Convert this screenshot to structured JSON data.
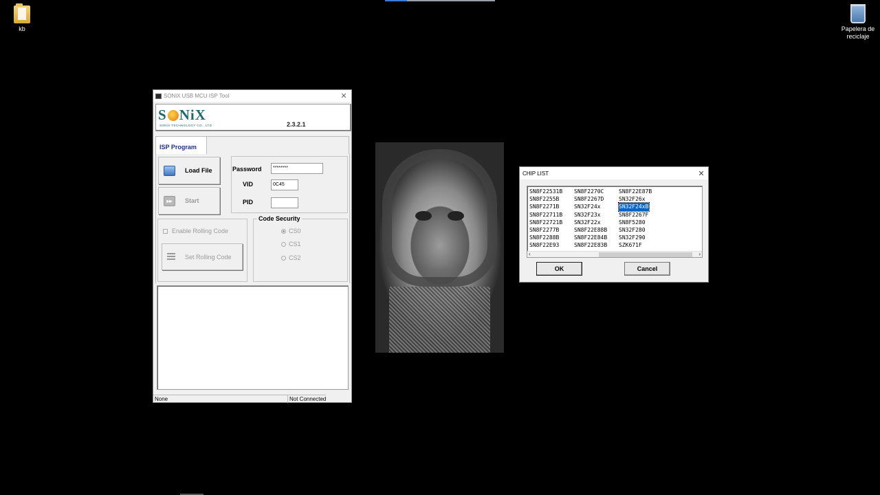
{
  "desktop": {
    "icons": [
      {
        "label": "kb"
      },
      {
        "label": "Papelera de reciclaje"
      }
    ]
  },
  "isp_window": {
    "title": "SONiX USB MCU ISP Tool",
    "logo": {
      "text_a": "S",
      "text_b": "NiX",
      "subtitle": "SONiX TECHNOLOGY CO., LTD"
    },
    "version": "2.3.2.1",
    "tab": "ISP Program",
    "load_file": "Load File",
    "start": "Start",
    "password_label": "Password",
    "password_value": "********",
    "vid_label": "VID",
    "vid_value": "0C45",
    "pid_label": "PID",
    "pid_value": "",
    "enable_rolling_code": "Enable Rolling Code",
    "set_rolling_code": "Set Rolling Code",
    "code_security_title": "Code Security",
    "cs_options": [
      "CS0",
      "CS1",
      "CS2"
    ],
    "status_left": "None",
    "status_right": "Not Connected"
  },
  "chip_list": {
    "title": "CHIP LIST",
    "columns": [
      [
        "SN8F22531B",
        "SN8F2255B",
        "SN8F2271B",
        "SN8F22711B",
        "SN8F22721B",
        "SN8F2277B",
        "SN8F2288B",
        "SN8F22E93"
      ],
      [
        "SN8F2270C",
        "SN8F2267D",
        "SN32F24x",
        "SN32F23x",
        "SN32F22x",
        "SN8F22E88B",
        "SN8F22E84B",
        "SN8F22E83B"
      ],
      [
        "SN8F22E87B",
        "SN32F26x",
        "SN32F24xB",
        "SN8F2267F",
        "SN8F5280",
        "SN32F280",
        "SN32F290",
        "SZK671F"
      ]
    ],
    "selected": "SN32F24xB",
    "ok": "OK",
    "cancel": "Cancel"
  }
}
